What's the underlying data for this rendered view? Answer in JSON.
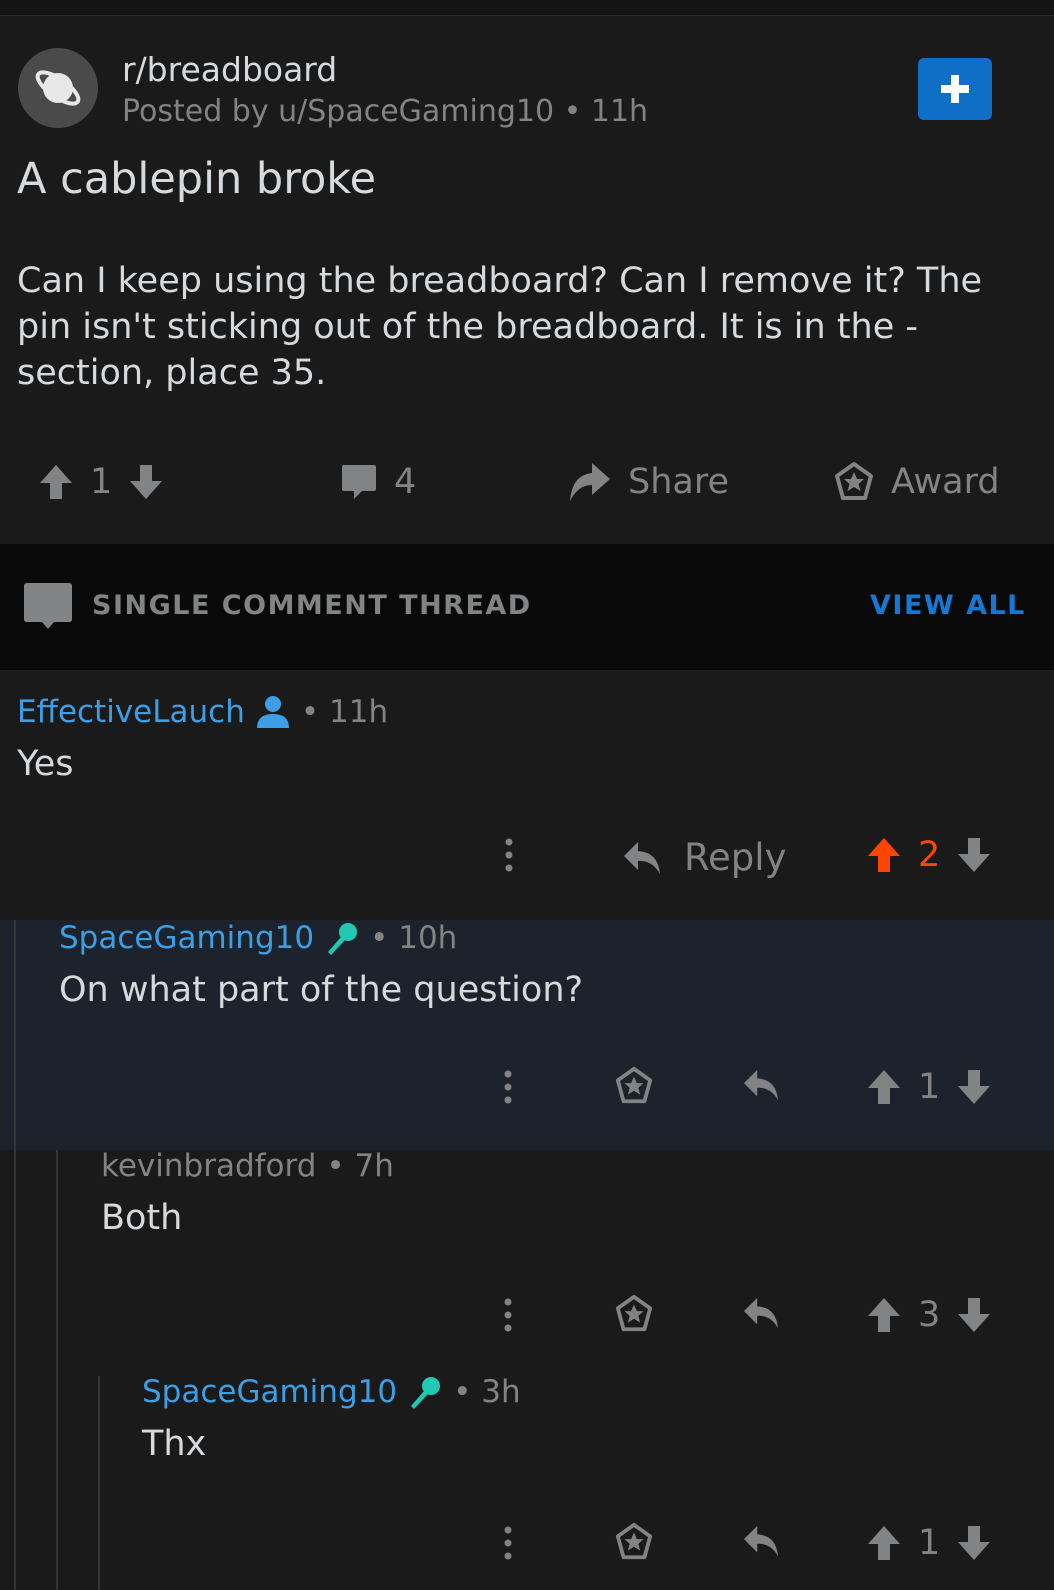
{
  "post": {
    "subreddit": "r/breadboard",
    "posted_by": "Posted by u/SpaceGaming10 • 11h",
    "title": "A cablepin broke",
    "body_lines": [
      "Can I keep using the breadboard? Can I remove it? The",
      "pin isn't sticking out of the breadboard. It is in the -",
      "section, place 35."
    ],
    "score": "1",
    "comments": "4",
    "share_label": "Share",
    "award_label": "Award"
  },
  "thread": {
    "label": "SINGLE COMMENT THREAD",
    "view_all": "VIEW ALL"
  },
  "comments": [
    {
      "author": "EffectiveLauch",
      "time": "• 11h",
      "text": "Yes",
      "reply_label": "Reply",
      "score": "2",
      "author_color": "#3c9fe6",
      "upvoted": true
    },
    {
      "author": "SpaceGaming10",
      "time": "• 10h",
      "text": "On what part of the question?",
      "score": "1",
      "author_color": "#3c9fe6"
    },
    {
      "author": "kevinbradford",
      "time": "• 7h",
      "text": "Both",
      "score": "3",
      "author_color": "#818384"
    },
    {
      "author": "SpaceGaming10",
      "time": "• 3h",
      "text": "Thx",
      "score": "1",
      "author_color": "#3c9fe6"
    }
  ],
  "colors": {
    "background": "#1a1a1b",
    "highlight": "#1c232c",
    "accent_blue": "#0f6fc6",
    "upvote": "#ff4500",
    "muted": "#818384",
    "op_badge": "#21c8b2"
  },
  "icons": {
    "subreddit": "planet-icon",
    "join": "plus-icon",
    "upvote": "arrow-up-icon",
    "downvote": "arrow-down-icon",
    "comments": "speech-bubble-icon",
    "share": "share-arrow-icon",
    "award": "star-badge-icon",
    "more": "vertical-dots-icon",
    "reply": "reply-arrow-icon",
    "user": "person-icon",
    "op": "microphone-icon"
  }
}
